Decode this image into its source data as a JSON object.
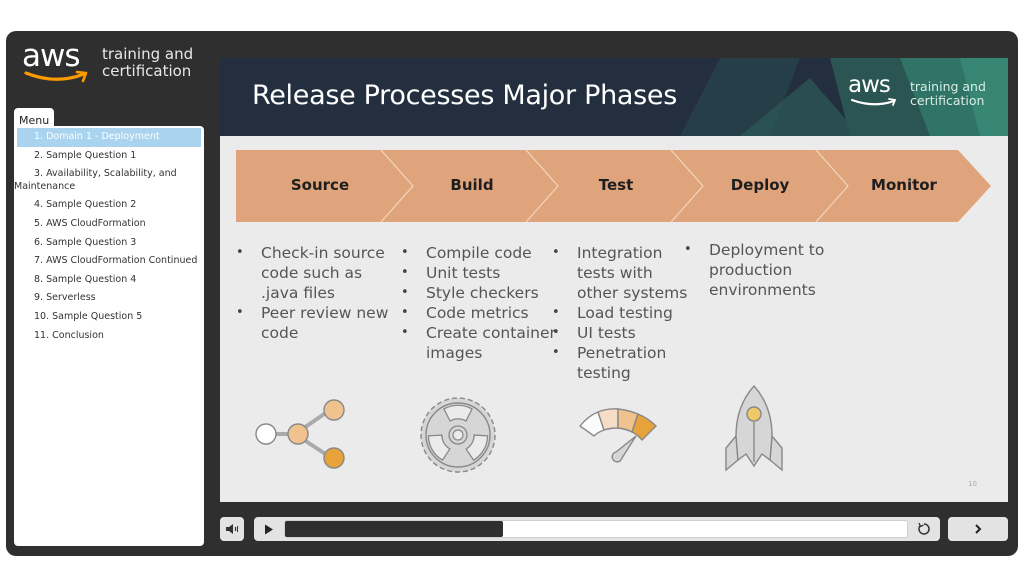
{
  "brand": {
    "logo_word": "aws",
    "tagline_line1": "training and",
    "tagline_line2": "certification",
    "accent_color": "#ff9900"
  },
  "menu": {
    "tab_label": "Menu",
    "items": [
      {
        "label": "1. Domain 1 - Deployment",
        "active": true
      },
      {
        "label": "2. Sample Question 1"
      },
      {
        "label": "3. Availability, Scalability, and",
        "continuation": "Maintenance"
      },
      {
        "label": "4. Sample Question 2"
      },
      {
        "label": "5. AWS CloudFormation"
      },
      {
        "label": "6. Sample Question 3"
      },
      {
        "label": "7. AWS CloudFormation Continued"
      },
      {
        "label": "8. Sample Question 4"
      },
      {
        "label": "9. Serverless"
      },
      {
        "label": "10. Sample Question 5"
      },
      {
        "label": "11. Conclusion"
      }
    ],
    "active_color": "#a9d3ee"
  },
  "slide": {
    "title": "Release Processes Major Phases",
    "header_logo_word": "aws",
    "header_tagline_line1": "training and",
    "header_tagline_line2": "certification",
    "phase_color": "#dfa47c",
    "phases": [
      {
        "name": "Source",
        "icon": "source-branch-icon",
        "bullets": [
          {
            "text": "Check-in source code such as .java files",
            "lines": [
              "Check-in source",
              "code such as",
              ".java files"
            ]
          },
          {
            "text": "Peer review new code",
            "lines": [
              "Peer review new",
              "code"
            ]
          }
        ]
      },
      {
        "name": "Build",
        "icon": "gear-icon",
        "bullets": [
          {
            "lines": [
              "Compile code"
            ]
          },
          {
            "lines": [
              "Unit tests"
            ]
          },
          {
            "lines": [
              "Style checkers"
            ]
          },
          {
            "lines": [
              "Code metrics"
            ]
          },
          {
            "lines": [
              "Create container",
              "images"
            ]
          }
        ]
      },
      {
        "name": "Test",
        "icon": "gauge-icon",
        "bullets": [
          {
            "lines": [
              "Integration",
              "tests with",
              "other systems"
            ]
          },
          {
            "lines": [
              "Load testing"
            ]
          },
          {
            "lines": [
              "UI tests"
            ]
          },
          {
            "lines": [
              "Penetration",
              "testing"
            ]
          }
        ]
      },
      {
        "name": "Deploy",
        "icon": "rocket-icon",
        "bullets": [
          {
            "lines": [
              "Deployment to",
              "production",
              "environments"
            ]
          }
        ]
      },
      {
        "name": "Monitor",
        "icon": "",
        "bullets": []
      }
    ],
    "slide_number": "10"
  },
  "player": {
    "volume_icon": "speaker-icon",
    "play_icon": "play-icon",
    "replay_icon": "replay-icon",
    "next_icon": "chevron-right-icon",
    "progress_fraction": 0.35
  }
}
